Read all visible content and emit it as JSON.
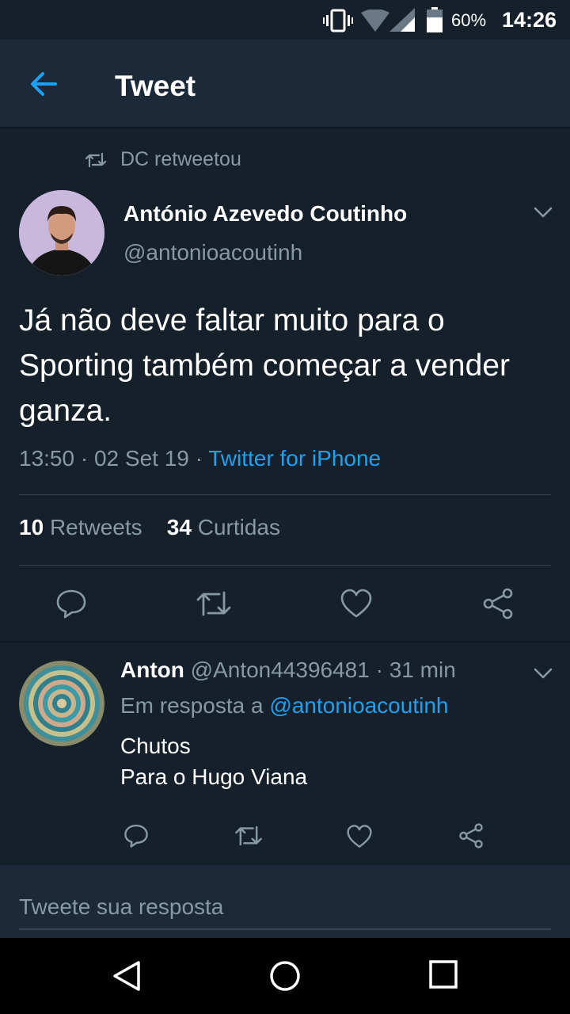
{
  "status_bar": {
    "battery_percent": "60%",
    "time": "14:26",
    "icons": [
      "vibrate-icon",
      "wifi-icon",
      "signal-icon",
      "battery-icon"
    ]
  },
  "app_bar": {
    "title": "Tweet",
    "back_icon": "arrow-left-icon"
  },
  "retweet_context": {
    "label": "DC retweetou",
    "icon": "retweet-icon"
  },
  "main_tweet": {
    "author_name": "António Azevedo Coutinho",
    "author_handle": "@antonioacoutinh",
    "text": "Já não deve faltar muito para o Sporting também começar a vender ganza.",
    "time": "13:50",
    "date": "02 Set 19",
    "separator": "·",
    "source": "Twitter for iPhone",
    "retweets_count": "10",
    "retweets_label": "Retweets",
    "likes_count": "34",
    "likes_label": "Curtidas",
    "actions": [
      "reply-icon",
      "retweet-icon",
      "like-icon",
      "share-icon"
    ]
  },
  "reply": {
    "author_name": "Anton",
    "author_handle": "@Anton44396481",
    "separator": "·",
    "time_ago": "31 min",
    "reply_to_prefix": "Em resposta a",
    "reply_to_handle": "@antonioacoutinh",
    "text_line1": "Chutos",
    "text_line2": "Para o Hugo Viana",
    "actions": [
      "reply-icon",
      "retweet-icon",
      "like-icon",
      "share-icon"
    ]
  },
  "composer": {
    "placeholder": "Tweete sua resposta"
  },
  "nav_bar": {
    "buttons": [
      "back-triangle-icon",
      "home-circle-icon",
      "recents-square-icon"
    ]
  },
  "colors": {
    "background": "#15202b",
    "bar": "#1c2938",
    "secondary_text": "#8899a6",
    "accent": "#1da1f2"
  }
}
